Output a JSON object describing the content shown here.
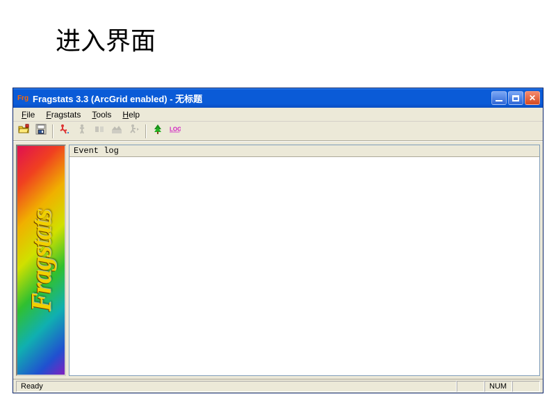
{
  "slide": {
    "title": "进入界面"
  },
  "window": {
    "title": "Fragstats 3.3 (ArcGrid enabled) - 无标题",
    "app_icon_text": "Frg"
  },
  "menu": {
    "file": "File",
    "fragstats": "Fragstats",
    "tools": "Tools",
    "help": "Help"
  },
  "toolbar": {
    "open": "open",
    "save": "save",
    "run_params": "run-params",
    "patch": "patch",
    "class": "class",
    "landscape": "landscape",
    "execute": "execute",
    "browse_results": "browse-results",
    "log": "log"
  },
  "sidebar": {
    "logo_text": "Fragstats"
  },
  "panel": {
    "header": "Event log"
  },
  "statusbar": {
    "ready": "Ready",
    "num": "NUM"
  }
}
